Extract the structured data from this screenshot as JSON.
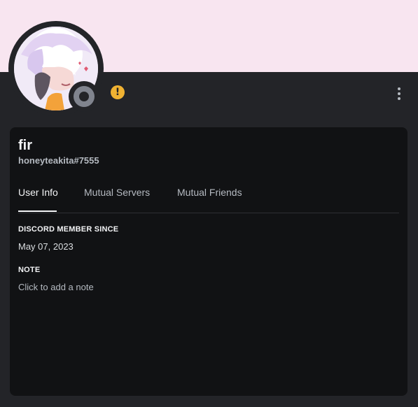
{
  "profile": {
    "display_name": "fir",
    "username": "honeyteakita#7555",
    "status": "offline",
    "status_icon": "offline-status-icon",
    "warning_icon": "warning-icon"
  },
  "tabs": [
    {
      "label": "User Info",
      "active": true
    },
    {
      "label": "Mutual Servers",
      "active": false
    },
    {
      "label": "Mutual Friends",
      "active": false
    }
  ],
  "info": {
    "member_since_heading": "DISCORD MEMBER SINCE",
    "member_since_value": "May 07, 2023",
    "note_heading": "NOTE",
    "note_placeholder": "Click to add a note"
  },
  "colors": {
    "banner": "#f8e5f0",
    "background": "#232428",
    "card": "#111214",
    "warning": "#f0b232",
    "offline": "#80848e"
  }
}
